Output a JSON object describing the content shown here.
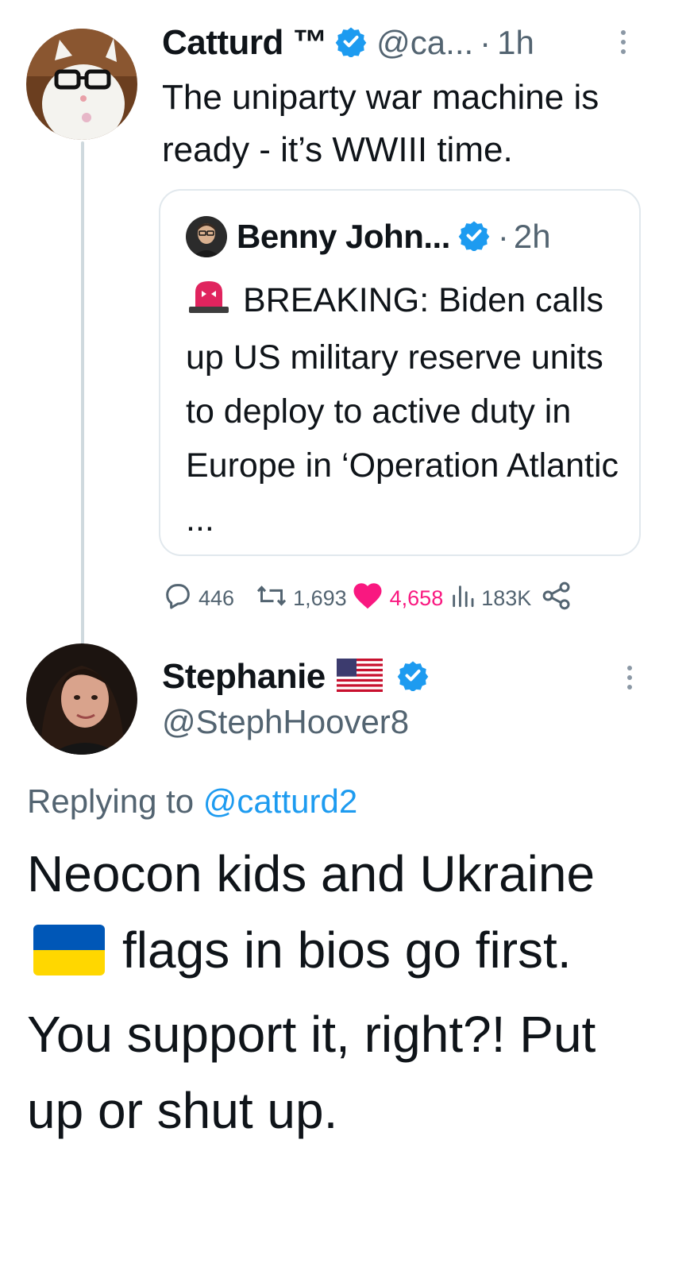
{
  "tweet": {
    "author_name": "Catturd ™",
    "handle": "@ca...",
    "separator": "·",
    "time": "1h",
    "text": "The uniparty war machine is ready - it’s WWIII time.",
    "quoted": {
      "author_name": "Benny John...",
      "separator": "·",
      "time": "2h",
      "text": "BREAKING: Biden calls up US military reserve units to deploy to active duty in Europe in ‘Operation Atlantic ..."
    },
    "stats": {
      "replies": "446",
      "retweets": "1,693",
      "likes": "4,658",
      "views": "183K"
    }
  },
  "reply": {
    "author_name": "Stephanie",
    "handle": "@StephHoover8",
    "replying_prefix": "Replying to",
    "replying_mention": "@catturd2",
    "text_part1": "Neocon kids and Ukraine",
    "text_part2": "flags in bios go first. You support it, right?! Put up or shut up."
  },
  "colors": {
    "verified": "#1d9bf0",
    "like": "#f91880",
    "secondary_text": "#536471",
    "link": "#1d9bf0"
  },
  "icons": [
    "verified-badge-icon",
    "more-vertical-icon",
    "reply-icon",
    "retweet-icon",
    "like-icon",
    "views-icon",
    "share-icon",
    "siren-icon",
    "us-flag-icon",
    "ukraine-flag-icon"
  ]
}
